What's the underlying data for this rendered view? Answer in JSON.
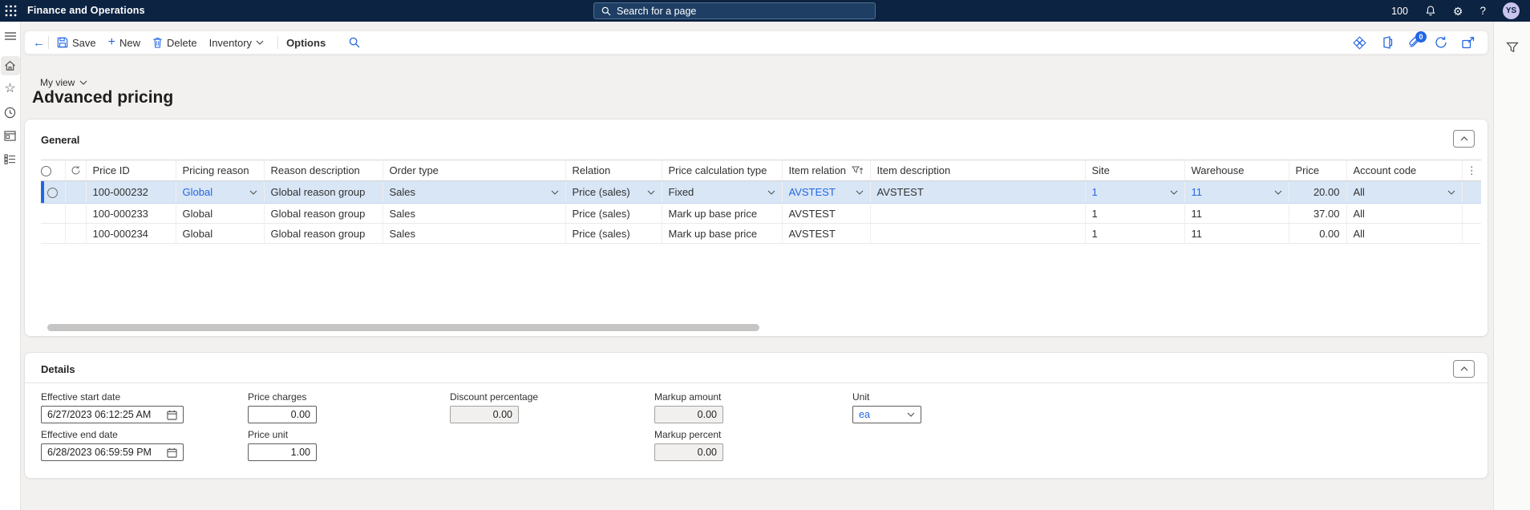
{
  "topbar": {
    "app_title": "Finance and Operations",
    "search_placeholder": "Search for a page",
    "environment_badge": "100",
    "avatar_initials": "YS"
  },
  "toolbar": {
    "save_label": "Save",
    "new_label": "New",
    "delete_label": "Delete",
    "inventory_label": "Inventory",
    "options_label": "Options",
    "attachments_count": "0"
  },
  "page": {
    "view_selector_label": "My view",
    "title": "Advanced pricing"
  },
  "icons": {
    "gear": "⚙",
    "help": "?",
    "star": "☆",
    "plus": "+",
    "back_arrow": "←",
    "more_vertical": "⋮"
  },
  "general": {
    "section_title": "General",
    "columns": {
      "price_id": "Price ID",
      "pricing_reason": "Pricing reason",
      "reason_description": "Reason description",
      "order_type": "Order type",
      "relation": "Relation",
      "price_calculation_type": "Price calculation type",
      "item_relation": "Item relation",
      "item_description": "Item description",
      "site": "Site",
      "warehouse": "Warehouse",
      "price": "Price",
      "account_code": "Account code"
    },
    "rows": [
      {
        "price_id": "100-000232",
        "pricing_reason": "Global",
        "reason_description": "Global reason group",
        "order_type": "Sales",
        "relation": "Price (sales)",
        "price_calculation_type": "Fixed",
        "item_relation": "AVSTEST",
        "item_description": "AVSTEST",
        "site": "1",
        "warehouse": "11",
        "price": "20.00",
        "account_code": "All",
        "selected": true
      },
      {
        "price_id": "100-000233",
        "pricing_reason": "Global",
        "reason_description": "Global reason group",
        "order_type": "Sales",
        "relation": "Price (sales)",
        "price_calculation_type": "Mark up base price",
        "item_relation": "AVSTEST",
        "item_description": "",
        "site": "1",
        "warehouse": "11",
        "price": "37.00",
        "account_code": "All",
        "selected": false
      },
      {
        "price_id": "100-000234",
        "pricing_reason": "Global",
        "reason_description": "Global reason group",
        "order_type": "Sales",
        "relation": "Price (sales)",
        "price_calculation_type": "Mark up base price",
        "item_relation": "AVSTEST",
        "item_description": "",
        "site": "1",
        "warehouse": "11",
        "price": "0.00",
        "account_code": "All",
        "selected": false
      }
    ]
  },
  "details": {
    "section_title": "Details",
    "fields": {
      "effective_start_date": {
        "label": "Effective start date",
        "value": "6/27/2023 06:12:25 AM"
      },
      "price_charges": {
        "label": "Price charges",
        "value": "0.00"
      },
      "discount_percentage": {
        "label": "Discount percentage",
        "value": "0.00"
      },
      "markup_amount": {
        "label": "Markup amount",
        "value": "0.00"
      },
      "unit": {
        "label": "Unit",
        "value": "ea"
      },
      "effective_end_date": {
        "label": "Effective end date",
        "value": "6/28/2023 06:59:59 PM"
      },
      "price_unit": {
        "label": "Price unit",
        "value": "1.00"
      },
      "markup_percent": {
        "label": "Markup percent",
        "value": "0.00"
      }
    }
  }
}
